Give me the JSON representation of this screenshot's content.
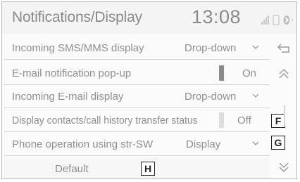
{
  "header": {
    "title": "Notifications/Display",
    "clock": "13:08"
  },
  "rows": [
    {
      "label": "Incoming SMS/MMS display",
      "value": "Drop‑down",
      "control": "dropdown"
    },
    {
      "label": "E-mail notification pop-up",
      "value": "On",
      "control": "toggle",
      "state": "on"
    },
    {
      "label": "Incoming E-mail display",
      "value": "Drop‑down",
      "control": "dropdown"
    },
    {
      "label": "Display contacts/call history transfer status",
      "value": "Off",
      "control": "toggle",
      "state": "off"
    },
    {
      "label": "Phone operation using str-SW",
      "value": "Display",
      "control": "dropdown"
    }
  ],
  "default_button": {
    "label": "Default"
  },
  "callouts": {
    "f": "F",
    "g": "G",
    "h": "H"
  },
  "side_buttons": [
    "back-icon",
    "scroll-up-icon",
    "scroll-down-icon"
  ],
  "colors": {
    "text": "#8f8f8f",
    "toggle_on": "#8b8b8b",
    "toggle_off": "#dedede"
  }
}
